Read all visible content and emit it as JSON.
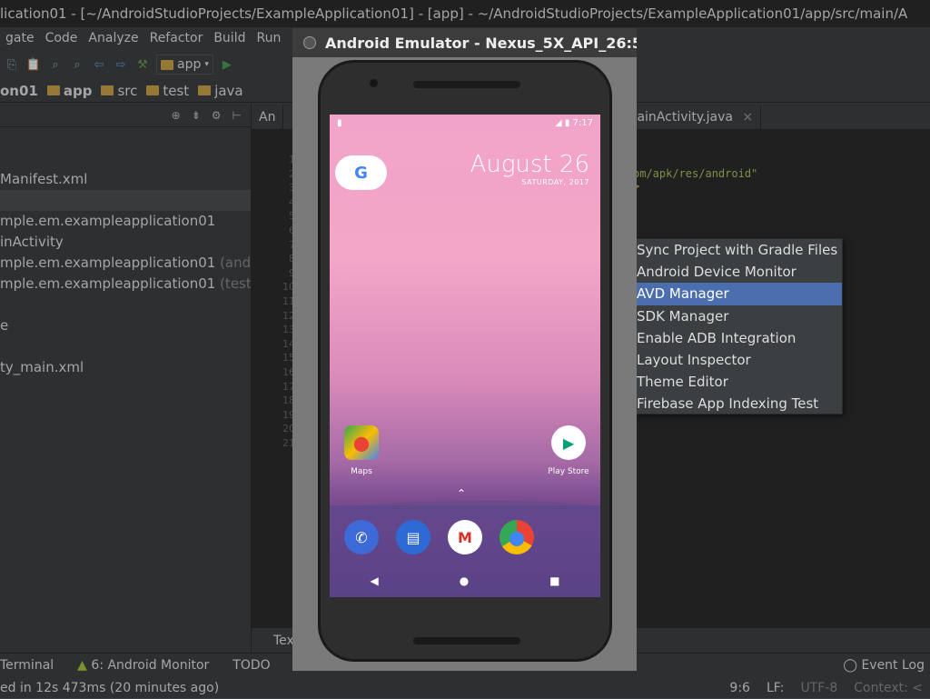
{
  "window_title": "lication01 - [~/AndroidStudioProjects/ExampleApplication01] - [app] - ~/AndroidStudioProjects/ExampleApplication01/app/src/main/A",
  "menu": [
    "gate",
    "Code",
    "Analyze",
    "Refactor",
    "Build",
    "Run"
  ],
  "toolbar": {
    "run_config": "app"
  },
  "breadcrumb": [
    "on01",
    "app",
    "src",
    "test",
    "java"
  ],
  "project_tree": [
    {
      "text": "Manifest.xml",
      "extra": ""
    },
    {
      "text": "",
      "extra": ""
    },
    {
      "text": "mple.em.exampleapplication01",
      "extra": ""
    },
    {
      "text": "inActivity",
      "extra": ""
    },
    {
      "text": "mple.em.exampleapplication01",
      "extra": " (andro"
    },
    {
      "text": "mple.em.exampleapplication01",
      "extra": " (test)"
    },
    {
      "text": "",
      "extra": ""
    },
    {
      "text": "e",
      "extra": ""
    },
    {
      "text": "",
      "extra": ""
    },
    {
      "text": "ty_main.xml",
      "extra": ""
    }
  ],
  "editor": {
    "tab_left": "An",
    "tab_right": "ainActivity.java",
    "line_numbers": [
      "1",
      "2",
      "3",
      "4",
      "5",
      "6",
      "7",
      "8",
      "9",
      "10",
      "11",
      "12",
      "13",
      "14",
      "15",
      "16",
      "17",
      "18",
      "19",
      "20",
      "21"
    ],
    "code_line1": "om/apk/res/android\"",
    "code_line2": ">",
    "bottom_tab": "Tex"
  },
  "context_menu": [
    {
      "label": "Sync Project with Gradle Files",
      "highlighted": false
    },
    {
      "label": "Android Device Monitor",
      "highlighted": false
    },
    {
      "label": "AVD Manager",
      "highlighted": true
    },
    {
      "label": "SDK Manager",
      "highlighted": false
    },
    {
      "label": "Enable ADB Integration",
      "highlighted": false
    },
    {
      "label": "Layout Inspector",
      "highlighted": false
    },
    {
      "label": "Theme Editor",
      "highlighted": false
    },
    {
      "label": "Firebase App Indexing Test",
      "highlighted": false
    }
  ],
  "status": {
    "tool_terminal": "Terminal",
    "tool_monitor": "6: Android Monitor",
    "tool_todo": "TODO",
    "tool_eventlog": "Event Log",
    "message": "ed in 12s 473ms (20 minutes ago)",
    "position": "9:6",
    "line_sep": "LF:",
    "encoding": "UTF-8",
    "context": "Context: <"
  },
  "emulator": {
    "title": "Android Emulator - Nexus_5X_API_26:5",
    "time": "7:17",
    "date": "August 26",
    "weekday": "SATURDAY, 2017",
    "google_glyph": "G",
    "apps": [
      {
        "label": "Maps",
        "icon": "maps-icon"
      },
      {
        "label": "Play Store",
        "icon": "play-store-icon"
      }
    ],
    "dock": [
      {
        "icon": "phone-icon"
      },
      {
        "icon": "messages-icon"
      },
      {
        "icon": "gmail-icon"
      },
      {
        "icon": "chrome-icon"
      }
    ]
  }
}
